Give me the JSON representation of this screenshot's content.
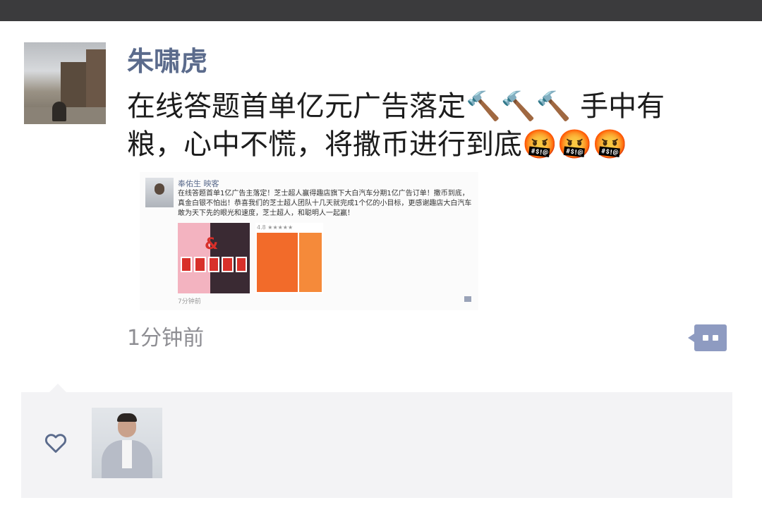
{
  "post": {
    "author": "朱啸虎",
    "text_line1": "在线答题首单亿元广告落定🔨🔨🔨 手中有",
    "text_line2": "粮，心中不慌，将撒币进行到底🤬🤬🤬",
    "time": "1分钟前"
  },
  "embedded": {
    "author": "奉佑生 映客",
    "text": "在线答题首单1亿广告主落定！芝士超人赢得趣店旗下大白汽车分期1亿广告订单！撒币到底，真金白银不怕出！恭喜我们的芝士超人团队十几天就完成1个亿的小目标，更感谢趣店大白汽车敢为天下先的眼光和速度，芝士超人，和聪明人一起赢！",
    "time": "7分钟前",
    "image1_amp": "&",
    "image2_stars": "4.8 ★★★★★"
  },
  "icons": {
    "comment": "comment-bubble-icon",
    "like": "heart-outline-icon"
  },
  "colors": {
    "author": "#5b6b8c",
    "comment_button": "#8e9bc1",
    "likes_panel": "#f3f3f5"
  }
}
